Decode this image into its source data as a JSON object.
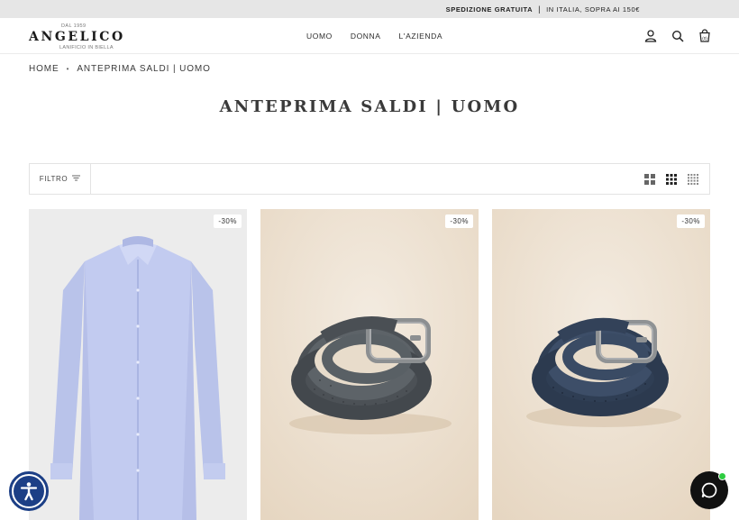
{
  "announcement": {
    "bold_text": "SPEDIZIONE GRATUITA",
    "separator": "|",
    "rest_text": "IN ITALIA, SOPRA AI 150€"
  },
  "logo": {
    "since": "DAL 1959",
    "name": "ANGELICO",
    "subtitle": "LANIFICIO IN BIELLA"
  },
  "nav": {
    "items": [
      "UOMO",
      "DONNA",
      "L'AZIENDA"
    ]
  },
  "header_icons": [
    "account-icon",
    "search-icon",
    "cart-icon"
  ],
  "cart": {
    "count": "(0)"
  },
  "breadcrumb": {
    "home": "HOME",
    "current": "ANTEPRIMA SALDI | UOMO"
  },
  "page_title": "ANTEPRIMA SALDI | UOMO",
  "filter": {
    "label": "FILTRO",
    "view_icons": [
      "grid-large-icon",
      "grid-medium-icon",
      "grid-small-icon"
    ]
  },
  "products": [
    {
      "badge": "-30%",
      "image": "light-blue-shirt"
    },
    {
      "badge": "-30%",
      "image": "grey-perforated-belt"
    },
    {
      "badge": "-30%",
      "image": "blue-perforated-belt"
    }
  ],
  "colors": {
    "accessibility": "#1c3f86",
    "chat": "#111111",
    "chat_online": "#2ecc40"
  }
}
